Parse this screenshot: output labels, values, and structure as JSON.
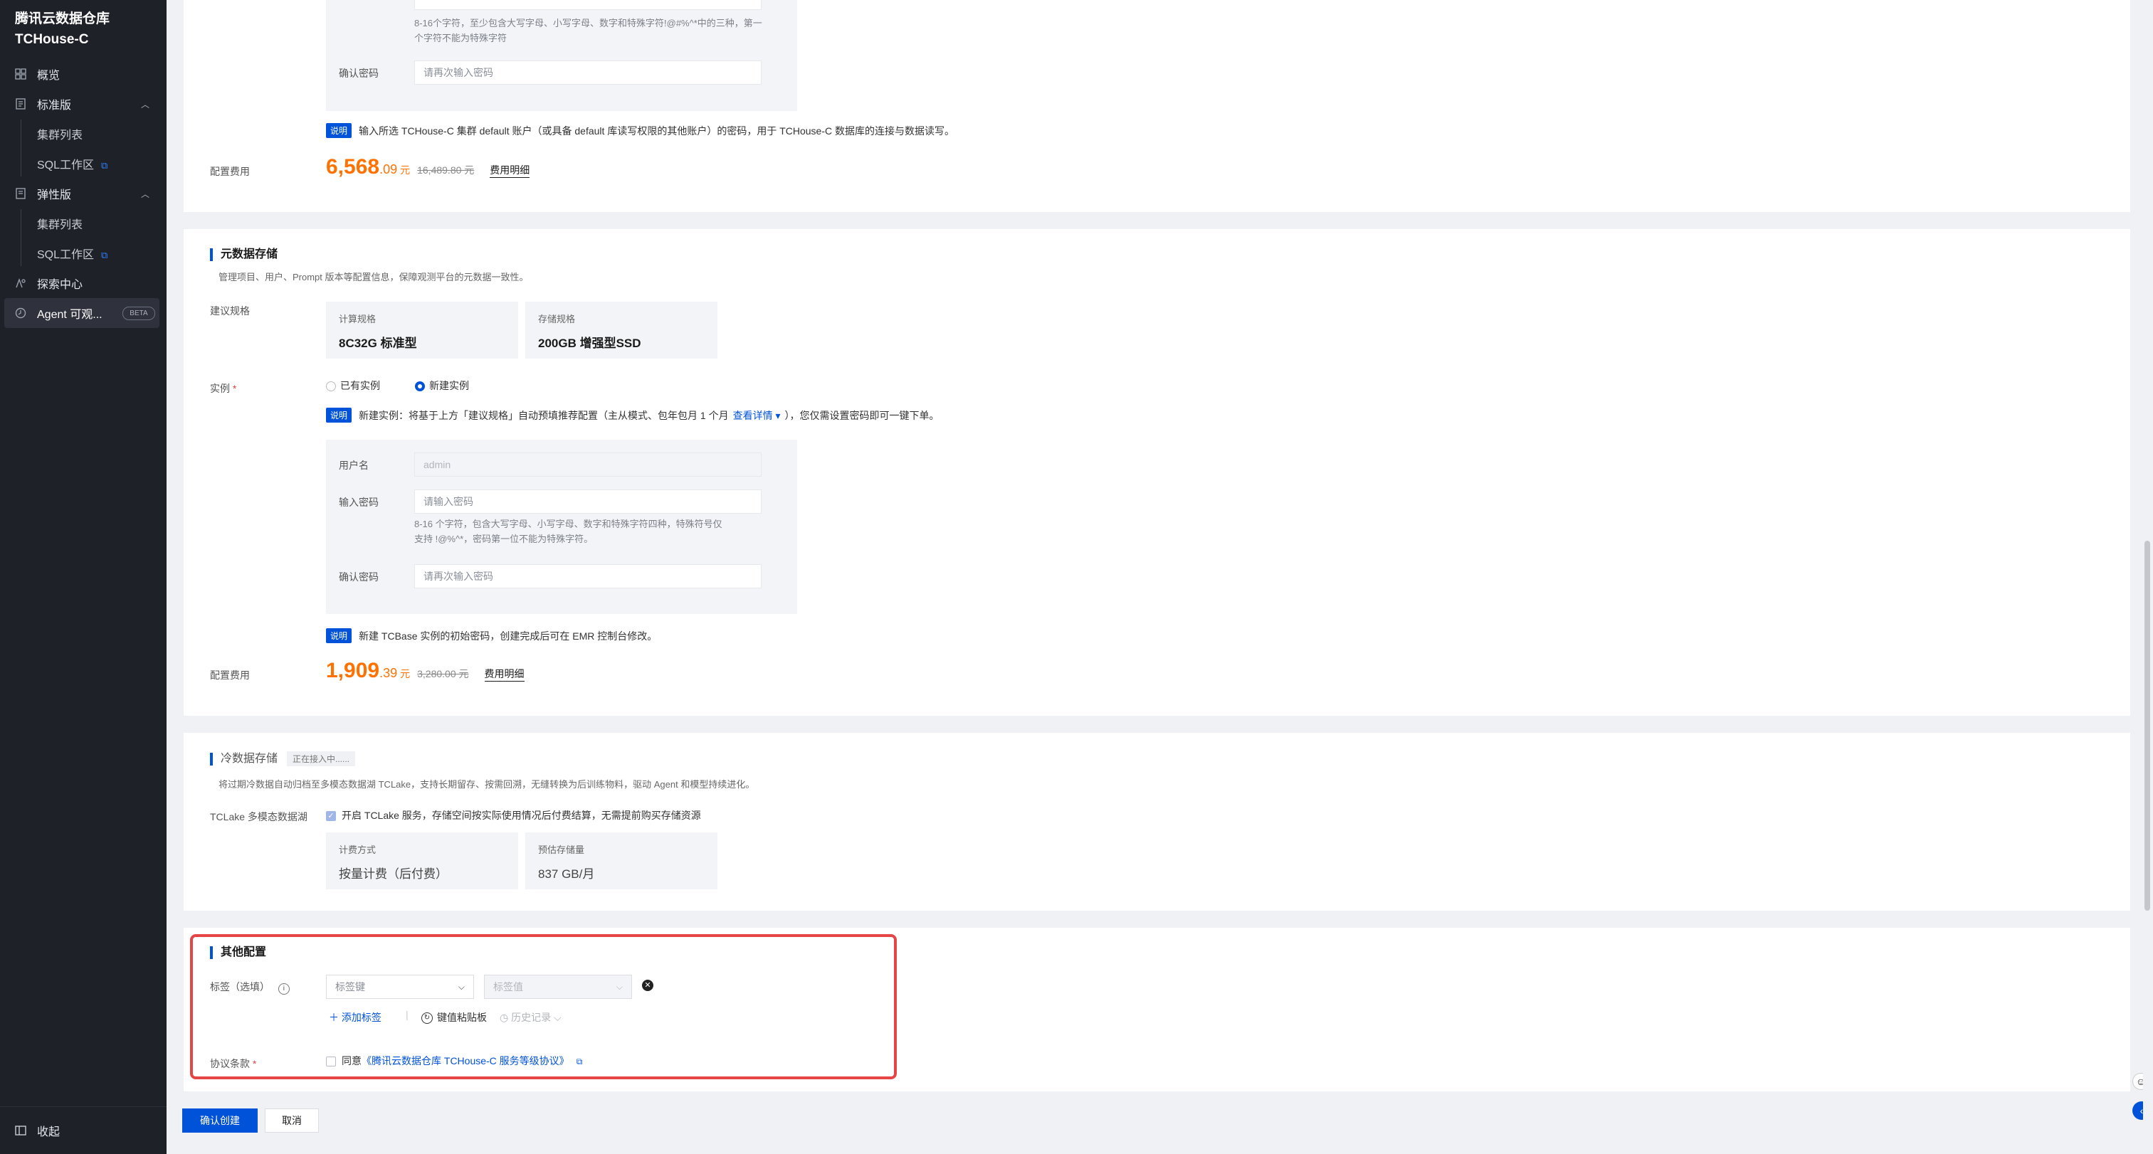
{
  "sidebar": {
    "brand_line1": "腾讯云数据仓库",
    "brand_line2": "TCHouse-C",
    "items": [
      {
        "label": "概览",
        "icon": "grid-icon"
      },
      {
        "label": "标准版",
        "icon": "document-icon"
      },
      {
        "label": "集群列表"
      },
      {
        "label": "SQL工作区",
        "external": true
      },
      {
        "label": "弹性版",
        "icon": "document-icon"
      },
      {
        "label": "集群列表"
      },
      {
        "label": "SQL工作区",
        "external": true
      },
      {
        "label": "探索中心",
        "icon": "explore-icon"
      },
      {
        "label": "Agent 可观...",
        "icon": "agent-icon",
        "badge": "BETA"
      }
    ],
    "collapse_label": "收起"
  },
  "top_section": {
    "hint": "8-16个字符，至少包含大写字母、小写字母、数字和特殊字符!@#%^*中的三种，第一个字符不能为特殊字符",
    "confirm_label": "确认密码",
    "confirm_placeholder": "请再次输入密码",
    "note_tag": "说明",
    "note_text": "输入所选 TCHouse-C 集群 default 账户（或具备 default 库读写权限的其他账户）的密码，用于 TCHouse-C 数据库的连接与数据读写。",
    "fee_label": "配置费用",
    "price_main": "6,568",
    "price_dec": ".09",
    "price_unit": "元",
    "price_old": "16,489.80 元",
    "fee_detail": "费用明细"
  },
  "metadata_section": {
    "title": "元数据存储",
    "desc": "管理项目、用户、Prompt 版本等配置信息，保障观测平台的元数据一致性。",
    "spec_label": "建议规格",
    "compute_key": "计算规格",
    "compute_value": "8C32G 标准型",
    "storage_key": "存储规格",
    "storage_value": "200GB 增强型SSD",
    "instance_label": "实例",
    "required_mark": "*",
    "option_existing": "已有实例",
    "option_new": "新建实例",
    "note_tag": "说明",
    "note_text_a": "新建实例：将基于上方「建议规格」自动预填推荐配置（主从模式、包年包月 1 个月",
    "note_link": "查看详情 ▾",
    "note_text_b": "），您仅需设置密码即可一键下单。",
    "username_label": "用户名",
    "username_value": "admin",
    "password_label": "输入密码",
    "password_placeholder": "请输入密码",
    "password_hint_1": "8-16 个字符，包含大写字母、小写字母、数字和特殊字符四种，特殊符号仅",
    "password_hint_2": "支持 !@%^*，密码第一位不能为特殊字符。",
    "confirm_label": "确认密码",
    "confirm_placeholder": "请再次输入密码",
    "note2_tag": "说明",
    "note2_text": "新建 TCBase 实例的初始密码，创建完成后可在 EMR 控制台修改。",
    "fee_label": "配置费用",
    "price_main": "1,909",
    "price_dec": ".39",
    "price_unit": "元",
    "price_old": "3,280.00 元",
    "fee_detail": "费用明细"
  },
  "cold_section": {
    "title": "冷数据存储",
    "status_tag": "正在接入中......",
    "desc": "将过期冷数据自动归档至多模态数据湖 TCLake，支持长期留存、按需回溯，无缝转换为后训练物料，驱动 Agent 和模型持续进化。",
    "lake_label": "TCLake 多模态数据湖",
    "lake_checkbox_text": "开启 TCLake 服务，存储空间按实际使用情况后付费结算，无需提前购买存储资源",
    "billing_key": "计费方式",
    "billing_value": "按量计费（后付费）",
    "estimate_key": "预估存储量",
    "estimate_value": "837 GB/月"
  },
  "other_section": {
    "title": "其他配置",
    "tag_label": "标签（选填）",
    "tag_key_placeholder": "标签键",
    "tag_value_placeholder": "标签值",
    "add_tag": "＋ 添加标签",
    "paste_board": "键值粘贴板",
    "history": "历史记录",
    "agreement_label": "协议条款",
    "agreement_required": "*",
    "agree_text": "同意",
    "agreement_link": "《腾讯云数据仓库 TCHouse-C 服务等级协议》"
  },
  "footer": {
    "confirm_button": "确认创建",
    "cancel_button": "取消"
  },
  "colors": {
    "primary": "#0052d9",
    "price": "#ff7200",
    "highlight": "#e54545",
    "sidebar_bg": "#1f2129"
  }
}
